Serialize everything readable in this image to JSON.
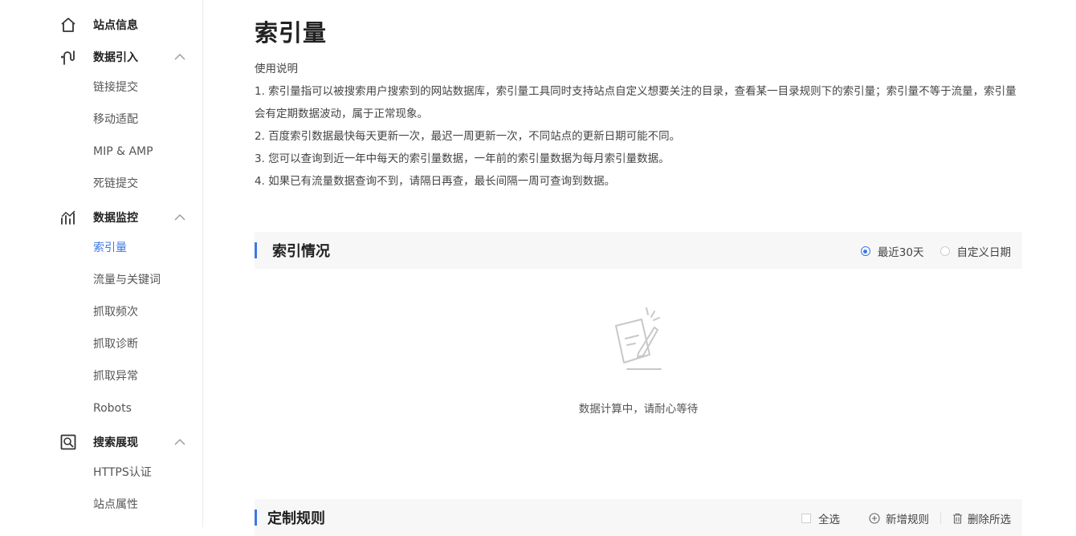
{
  "sidebar": {
    "groups": [
      {
        "label": "站点信息",
        "icon": "home-icon"
      },
      {
        "label": "数据引入",
        "icon": "data-import-icon",
        "items": [
          "链接提交",
          "移动适配",
          "MIP & AMP",
          "死链提交"
        ]
      },
      {
        "label": "数据监控",
        "icon": "chart-icon",
        "items": [
          "索引量",
          "流量与关键词",
          "抓取频次",
          "抓取诊断",
          "抓取异常",
          "Robots"
        ],
        "active_item": "索引量"
      },
      {
        "label": "搜索展现",
        "icon": "search-display-icon",
        "items": [
          "HTTPS认证",
          "站点属性"
        ]
      }
    ]
  },
  "page": {
    "title": "索引量",
    "usage_heading": "使用说明",
    "usage_lines": [
      "1. 索引量指可以被搜索用户搜索到的网站数据库，索引量工具同时支持站点自定义想要关注的目录，查看某一目录规则下的索引量；索引量不等于流量，索引量会有定期数据波动，属于正常现象。",
      "2. 百度索引数据最快每天更新一次，最迟一周更新一次，不同站点的更新日期可能不同。",
      "3. 您可以查询到近一年中每天的索引量数据，一年前的索引量数据为每月索引量数据。",
      "4. 如果已有流量数据查询不到，请隔日再查，最长间隔一周可查询到数据。"
    ]
  },
  "index_section": {
    "title": "索引情况",
    "radio_last30": "最近30天",
    "radio_custom": "自定义日期",
    "selected": "最近30天",
    "empty_text": "数据计算中，请耐心等待"
  },
  "rules_section": {
    "title": "定制规则",
    "select_all": "全选",
    "add_rule": "新增规则",
    "delete_selected": "删除所选"
  },
  "colors": {
    "accent": "#3b78e7",
    "section_bg": "#f7f7f7"
  }
}
